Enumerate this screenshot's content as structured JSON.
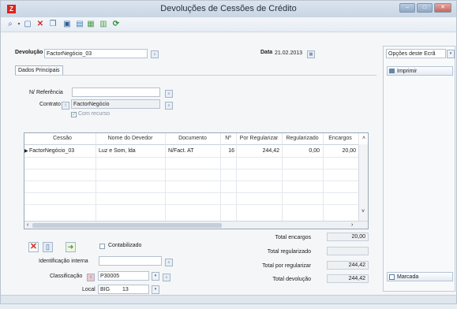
{
  "window": {
    "title": "Devoluções de Cessões de Crédito",
    "app_icon_letter": "Z"
  },
  "header": {
    "devolucao_label": "Devolução",
    "devolucao_value": "FactorNegócio_03",
    "data_label": "Data",
    "data_value": "21.02.2013"
  },
  "tabs": [
    {
      "label": "Dados Principais"
    }
  ],
  "form": {
    "ref_label": "N/ Referência",
    "ref_value": "",
    "contrato_label": "Contrato",
    "contrato_value": "FactorNegócio",
    "com_recurso_label": "Com recurso"
  },
  "grid": {
    "columns": [
      "Cessão",
      "Nome do Devedor",
      "Documento",
      "Nº",
      "Por Regularizar",
      "Regularizado",
      "Encargos"
    ],
    "rows": [
      {
        "cessao": "FactorNegócio_03",
        "devedor": "Luz e Som, lda",
        "documento": "N/Fact. AT",
        "numero": "16",
        "por_regularizar": "244,42",
        "regularizado": "0,00",
        "encargos": "20,00"
      }
    ]
  },
  "bottom": {
    "contabilizado_label": "Contabilizado",
    "identificacao_label": "Identificação interna",
    "identificacao_value": "",
    "classificacao_label": "Classificação",
    "classificacao_value": "P30005",
    "local_label": "Local",
    "local_code": "BIG",
    "local_num": "13"
  },
  "totals": {
    "encargos_label": "Total encargos",
    "encargos_value": "20,00",
    "regularizado_label": "Total regularizado",
    "regularizado_value": "",
    "por_regularizar_label": "Total por regularizar",
    "por_regularizar_value": "244,42",
    "devolucao_label": "Total devolução",
    "devolucao_value": "244,42"
  },
  "sidebar": {
    "options_select": "Opções deste Ecrã",
    "imprimir_label": "Imprimir",
    "marcada_label": "Marcada"
  },
  "colors": {
    "titlebar": "#c9d5e3",
    "accent_red": "#d9251d",
    "delete_red": "#d12a1e"
  }
}
